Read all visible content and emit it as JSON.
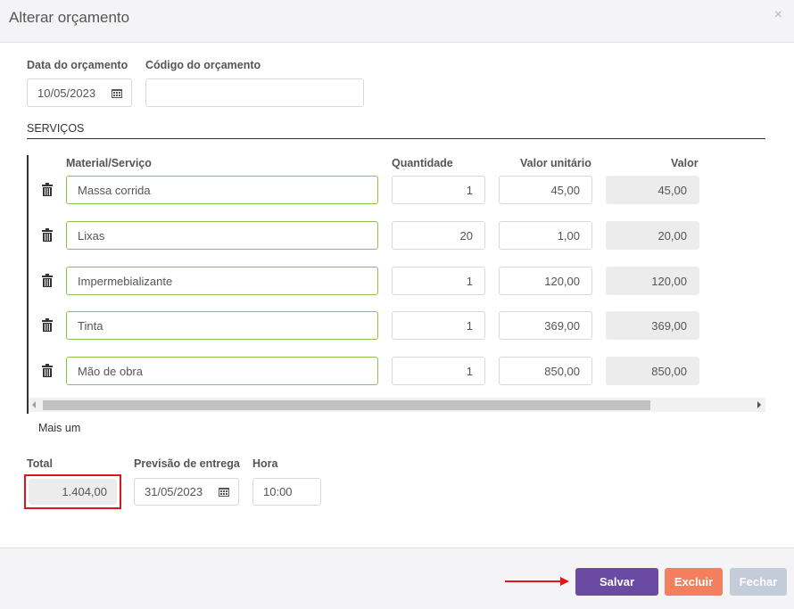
{
  "dialog": {
    "title": "Alterar orçamento",
    "close_icon": "×"
  },
  "fields": {
    "data_label": "Data do orçamento",
    "data_value": "10/05/2023",
    "codigo_label": "Código do orçamento",
    "codigo_value": ""
  },
  "servicos": {
    "title": "SERVIÇOS",
    "headers": {
      "material": "Material/Serviço",
      "quantidade": "Quantidade",
      "valor_unitario": "Valor unitário",
      "valor": "Valor"
    },
    "rows": [
      {
        "material": "Massa corrida",
        "quantidade": "1",
        "valor_unitario": "45,00",
        "valor": "45,00"
      },
      {
        "material": "Lixas",
        "quantidade": "20",
        "valor_unitario": "1,00",
        "valor": "20,00"
      },
      {
        "material": "Impermebializante",
        "quantidade": "1",
        "valor_unitario": "120,00",
        "valor": "120,00"
      },
      {
        "material": "Tinta",
        "quantidade": "1",
        "valor_unitario": "369,00",
        "valor": "369,00"
      },
      {
        "material": "Mão de obra",
        "quantidade": "1",
        "valor_unitario": "850,00",
        "valor": "850,00"
      }
    ],
    "add_link": "Mais um"
  },
  "summary": {
    "total_label": "Total",
    "total_value": "1.404,00",
    "previsao_label": "Previsão de entrega",
    "previsao_value": "31/05/2023",
    "hora_label": "Hora",
    "hora_value": "10:00"
  },
  "footer": {
    "salvar": "Salvar",
    "excluir": "Excluir",
    "fechar": "Fechar"
  },
  "colors": {
    "salvar_bg": "#6b4aa3",
    "excluir_bg": "#f47f5e",
    "fechar_bg": "#c3ccd8",
    "highlight": "#e0141b",
    "material_border": "#8bc34a"
  },
  "icons": {
    "trash": "trash-icon",
    "calendar": "calendar-icon",
    "arrow": "red-arrow-annotation"
  }
}
